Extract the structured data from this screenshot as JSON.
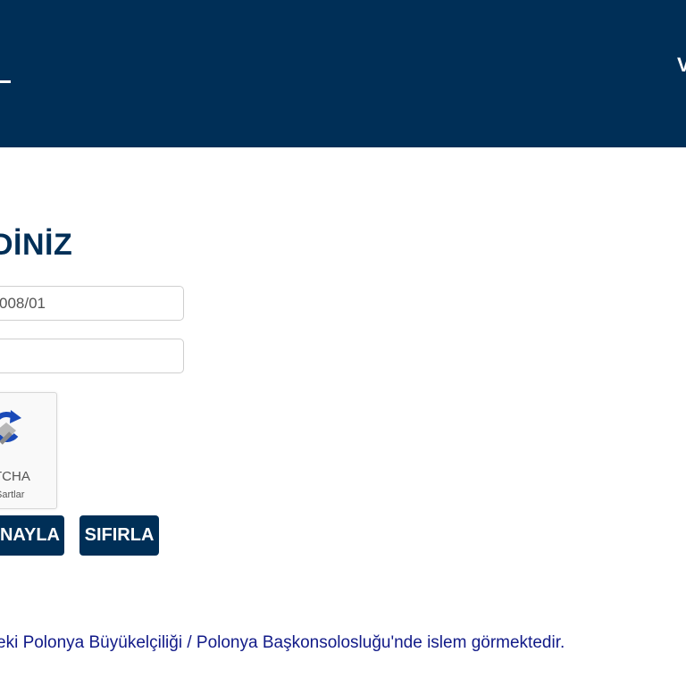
{
  "header": {
    "background": "#002f57"
  },
  "form": {
    "title": "DİNİZ",
    "application_number_value": "008/01",
    "second_field_value": "",
    "captcha": {
      "icon": "recaptcha-icon",
      "brand_text": "TCHA",
      "terms_text": "Şartlar"
    },
    "buttons": {
      "confirm_label": "ONAYLA",
      "reset_label": "SIFIRLA"
    }
  },
  "footer": {
    "info_text": "eki Polonya Büyükelçiliği / Polonya Başkonsolosluğu'nde islem görmektedir."
  },
  "colors": {
    "primary": "#002f57",
    "link_text": "#111a88",
    "input_border": "#cfcfcf"
  }
}
